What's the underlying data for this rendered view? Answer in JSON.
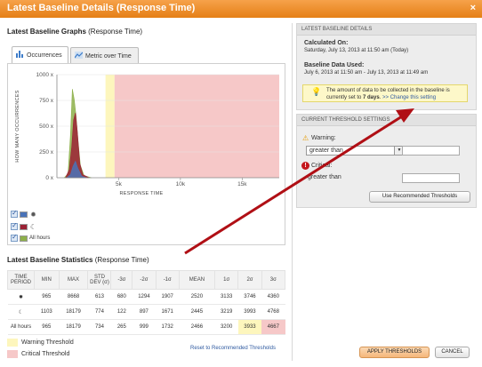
{
  "window": {
    "title": "Latest Baseline Details (Response Time)",
    "close_glyph": "×"
  },
  "graphs": {
    "heading_bold": "Latest Baseline Graphs",
    "heading_rest": " (Response Time)",
    "tabs": [
      {
        "label": "Occurrences"
      },
      {
        "label": "Metric over Time"
      }
    ],
    "legend": {
      "all_hours_label": "All hours"
    }
  },
  "chart_data": {
    "type": "area",
    "xlabel": "RESPONSE TIME",
    "ylabel": "HOW MANY OCCURRENCES",
    "xlim": [
      0,
      18000
    ],
    "ylim": [
      0,
      1000
    ],
    "x_ticks": [
      {
        "value": 5000,
        "label": "5k"
      },
      {
        "value": 10000,
        "label": "10k"
      },
      {
        "value": 15000,
        "label": "15k"
      }
    ],
    "y_ticks": [
      {
        "value": 0,
        "label": "0 x"
      },
      {
        "value": 250,
        "label": "250 x"
      },
      {
        "value": 500,
        "label": "500 x"
      },
      {
        "value": 750,
        "label": "750 x"
      },
      {
        "value": 1000,
        "label": "1000 x"
      }
    ],
    "warning_band": [
      3933,
      4667
    ],
    "critical_band": [
      4667,
      18000
    ],
    "series": [
      {
        "color": "#8db04a",
        "points": [
          [
            600,
            0
          ],
          [
            900,
            40
          ],
          [
            1100,
            420
          ],
          [
            1250,
            860
          ],
          [
            1400,
            760
          ],
          [
            1550,
            600
          ],
          [
            1700,
            370
          ],
          [
            1900,
            120
          ],
          [
            2200,
            20
          ],
          [
            2800,
            0
          ]
        ]
      },
      {
        "color": "#9b2235",
        "points": [
          [
            700,
            0
          ],
          [
            1000,
            80
          ],
          [
            1200,
            300
          ],
          [
            1350,
            560
          ],
          [
            1500,
            630
          ],
          [
            1650,
            450
          ],
          [
            1850,
            140
          ],
          [
            2100,
            30
          ],
          [
            2600,
            0
          ]
        ]
      },
      {
        "color": "#4a73b8",
        "points": [
          [
            800,
            0
          ],
          [
            1100,
            30
          ],
          [
            1300,
            110
          ],
          [
            1500,
            160
          ],
          [
            1700,
            90
          ],
          [
            2000,
            15
          ],
          [
            2400,
            0
          ]
        ]
      }
    ]
  },
  "stats": {
    "heading_bold": "Latest Baseline Statistics",
    "heading_rest": " (Response Time)",
    "columns": [
      "TIME PERIOD",
      "MIN",
      "MAX",
      "STD DEV (σ)",
      "-3σ",
      "-2σ",
      "-1σ",
      "MEAN",
      "1σ",
      "2σ",
      "3σ"
    ],
    "rows": [
      {
        "period": "sun-icon",
        "cells": [
          "965",
          "8668",
          "613",
          "680",
          "1294",
          "1907",
          "2520",
          "3133",
          "3746",
          "4360"
        ]
      },
      {
        "period": "moon-icon",
        "cells": [
          "1103",
          "18179",
          "774",
          "122",
          "897",
          "1671",
          "2445",
          "3219",
          "3993",
          "4768"
        ]
      },
      {
        "period_label": "All hours",
        "cells": [
          "965",
          "18179",
          "734",
          "265",
          "999",
          "1732",
          "2466",
          "3200",
          "3933",
          "4667"
        ]
      }
    ],
    "warning_label": "Warning Threshold",
    "critical_label": "Critical Threshold",
    "reset_link": "Reset to Recommended Thresholds"
  },
  "baseline_details": {
    "header": "LATEST BASELINE DETAILS",
    "calculated_label": "Calculated On:",
    "calculated_value": "Saturday, July 13, 2013 at 11:50 am (Today)",
    "data_used_label": "Baseline Data Used:",
    "data_used_value": "July 6, 2013 at 11:50 am - July 13, 2013 at 11:49 am",
    "info_text_pre": "The amount of data to be collected in the baseline is currently set to ",
    "info_days": "7 days",
    "info_text_post": ". ",
    "info_link": ">> Change this setting"
  },
  "thresholds": {
    "header": "CURRENT THRESHOLD SETTINGS",
    "warning_label": "Warning:",
    "warning_operator": "greater than",
    "warning_value": "",
    "critical_label": "Critical:",
    "critical_operator": "greater than",
    "critical_value": "",
    "use_recommended_button": "Use Recommended Thresholds"
  },
  "footer": {
    "apply_button": "APPLY THRESHOLDS",
    "cancel_button": "CANCEL"
  },
  "colors": {
    "title_orange": "#e57f16",
    "warning_yellow": "#fdf6bd",
    "critical_pink": "#f6c8c8",
    "arrow_red": "#b00f15"
  }
}
